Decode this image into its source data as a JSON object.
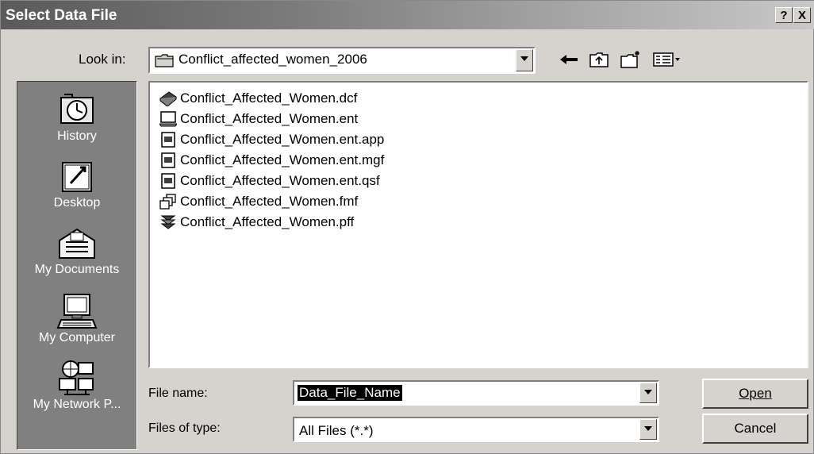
{
  "window": {
    "title": "Select Data File",
    "help_label": "?",
    "close_label": "X"
  },
  "lookin": {
    "label": "Look in:",
    "folder": "Conflict_affected_women_2006"
  },
  "toolbar": {
    "icons": [
      "back-arrow-icon",
      "up-folder-icon",
      "new-folder-icon",
      "view-menu-icon"
    ]
  },
  "places": [
    {
      "label": "History",
      "icon": "history-icon"
    },
    {
      "label": "Desktop",
      "icon": "desktop-icon"
    },
    {
      "label": "My Documents",
      "icon": "my-documents-icon"
    },
    {
      "label": "My Computer",
      "icon": "my-computer-icon"
    },
    {
      "label": "My Network P...",
      "icon": "my-network-places-icon"
    }
  ],
  "files": [
    {
      "name": "Conflict_Affected_Women.dcf",
      "icon": "dictionary-book-icon"
    },
    {
      "name": "Conflict_Affected_Women.ent",
      "icon": "computer-entry-icon"
    },
    {
      "name": "Conflict_Affected_Women.ent.app",
      "icon": "document-file-icon"
    },
    {
      "name": "Conflict_Affected_Women.ent.mgf",
      "icon": "document-file-icon"
    },
    {
      "name": "Conflict_Affected_Women.ent.qsf",
      "icon": "document-file-icon"
    },
    {
      "name": "Conflict_Affected_Women.fmf",
      "icon": "forms-file-icon"
    },
    {
      "name": "Conflict_Affected_Women.pff",
      "icon": "program-file-icon"
    }
  ],
  "filename": {
    "label": "File name:",
    "value": "Data_File_Name"
  },
  "filetype": {
    "label": "Files of type:",
    "value": "All Files  (*.*)"
  },
  "buttons": {
    "open": "Open",
    "cancel": "Cancel"
  }
}
